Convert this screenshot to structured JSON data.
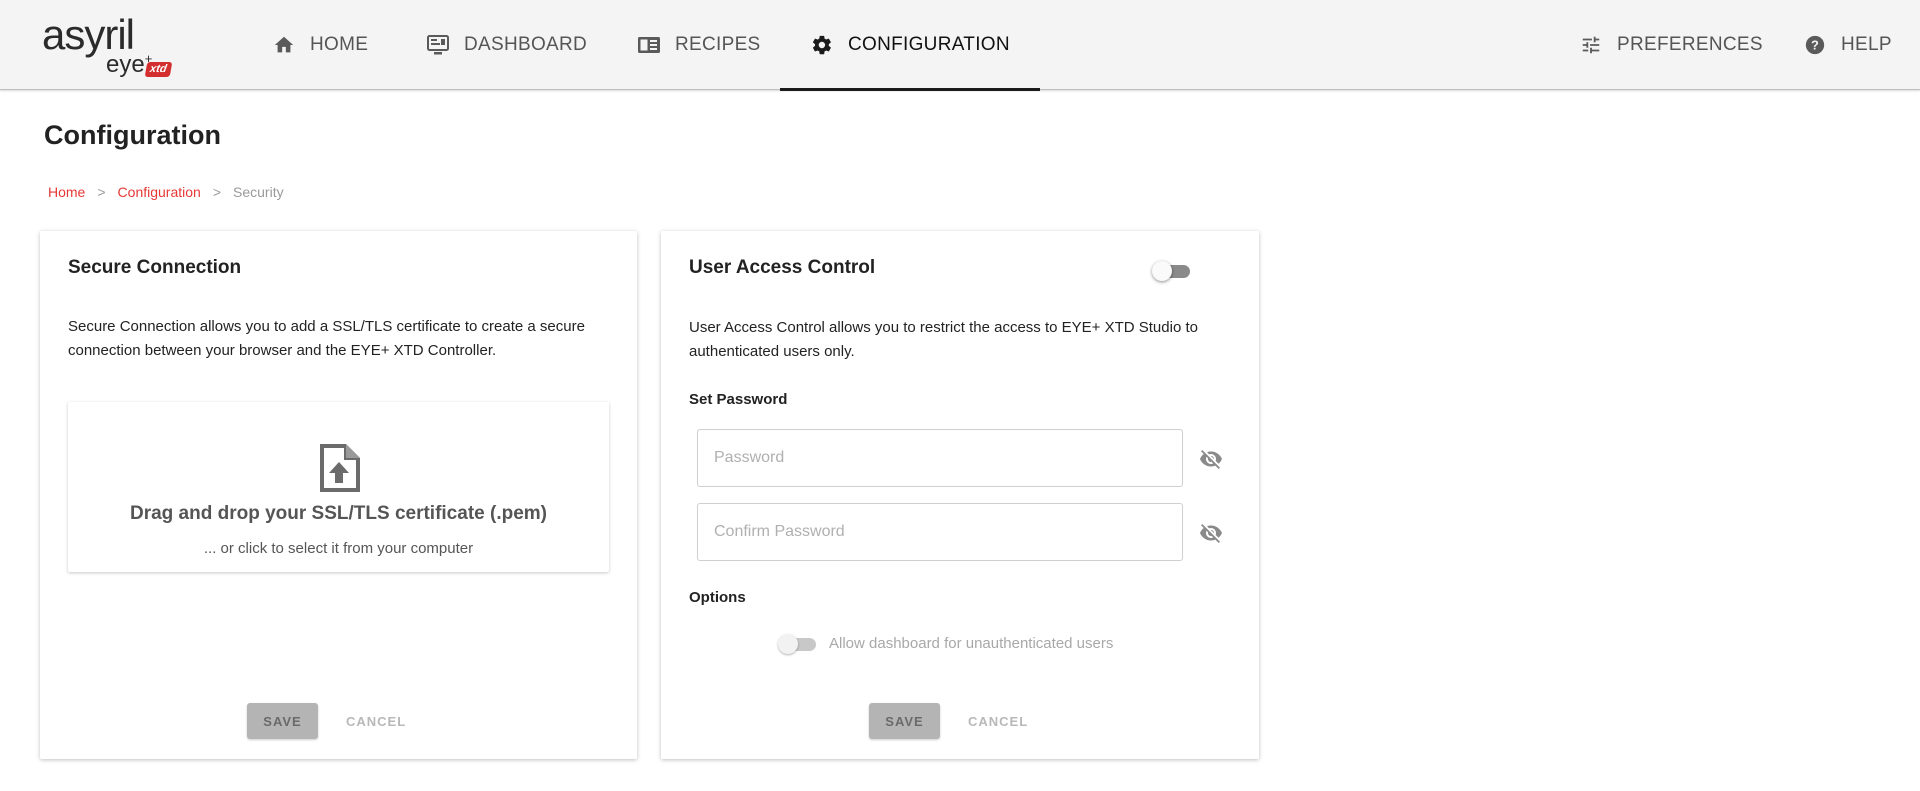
{
  "app": {
    "logo_word": "asyril",
    "logo_sub": "eye",
    "logo_sup": "+",
    "logo_badge": "xtd"
  },
  "nav": {
    "home": "HOME",
    "dashboard": "DASHBOARD",
    "recipes": "RECIPES",
    "configuration": "CONFIGURATION",
    "preferences": "PREFERENCES",
    "help": "HELP",
    "active": "configuration"
  },
  "page": {
    "title": "Configuration"
  },
  "breadcrumb": {
    "items": [
      "Home",
      "Configuration",
      "Security"
    ],
    "separator": ">"
  },
  "secure": {
    "title": "Secure Connection",
    "description": "Secure Connection allows you to add a SSL/TLS certificate to create a secure connection between your browser and the EYE+ XTD Controller.",
    "drop_title": "Drag and drop your SSL/TLS certificate (.pem)",
    "drop_sub": "... or click to select it from your computer",
    "save": "SAVE",
    "cancel": "CANCEL"
  },
  "access": {
    "title": "User Access Control",
    "enabled": false,
    "description": "User Access Control allows you to restrict the access to EYE+ XTD Studio to authenticated users only.",
    "set_password_label": "Set Password",
    "password_placeholder": "Password",
    "confirm_placeholder": "Confirm Password",
    "options_label": "Options",
    "allow_dashboard_label": "Allow dashboard for unauthenticated users",
    "allow_dashboard_enabled": false,
    "save": "SAVE",
    "cancel": "CANCEL"
  },
  "colors": {
    "accent_red": "#e53935",
    "badge_red": "#d32f2f",
    "nav_bg": "#f4f4f4",
    "disabled_button": "#b4b4b4"
  }
}
